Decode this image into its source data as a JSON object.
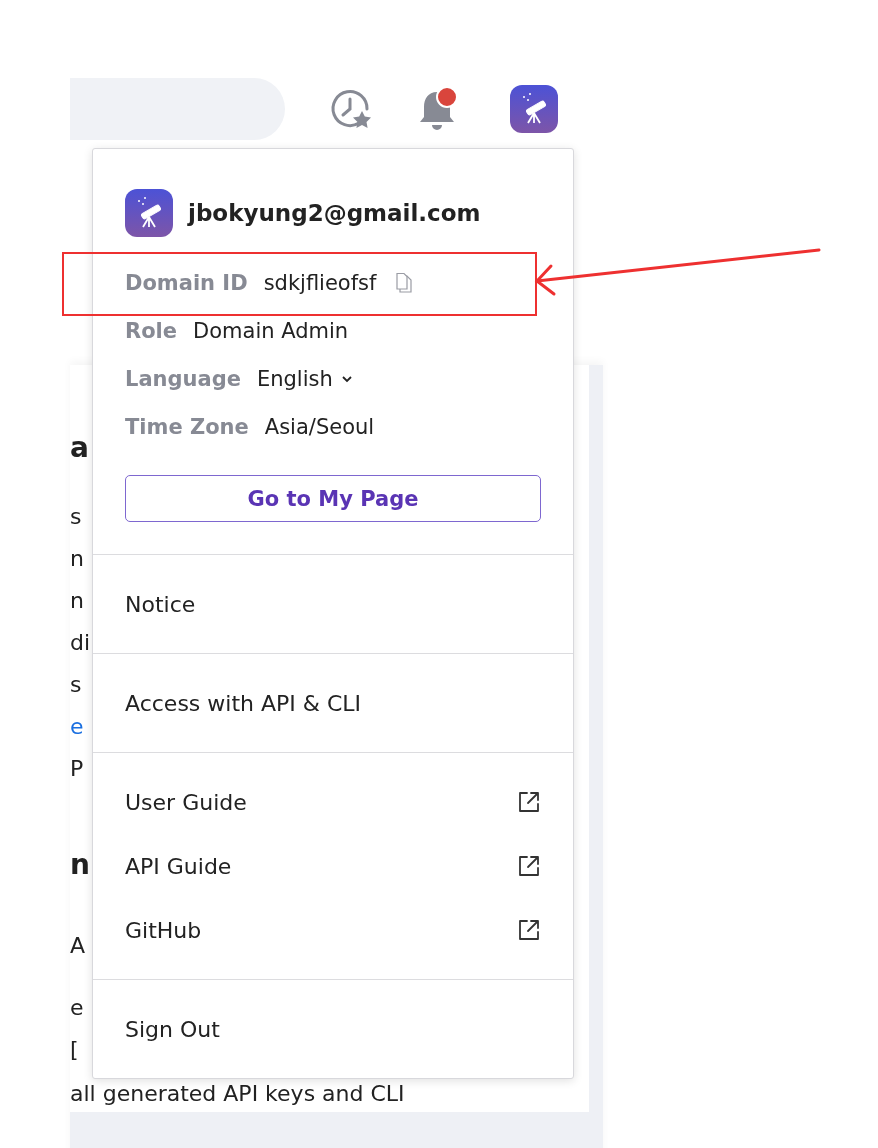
{
  "notifications": {
    "unread": true
  },
  "background_page": {
    "lines": [
      {
        "text": "a",
        "kind": "heading"
      },
      {
        "text": "s",
        "kind": "text"
      },
      {
        "text": "n",
        "kind": "text"
      },
      {
        "text": "n",
        "kind": "text"
      },
      {
        "text": "di",
        "kind": "text"
      },
      {
        "text": "s",
        "kind": "text"
      },
      {
        "text": "e",
        "kind": "link"
      },
      {
        "text": "P",
        "kind": "text"
      },
      {
        "text": "n",
        "kind": "heading"
      },
      {
        "text": "A",
        "kind": "text"
      },
      {
        "text": "e",
        "kind": "text"
      },
      {
        "text": "[",
        "kind": "text"
      },
      {
        "text": "all generated API keys and CLI",
        "kind": "text"
      }
    ]
  },
  "account_menu": {
    "email": "jbokyung2@gmail.com",
    "details": [
      {
        "label": "Domain ID",
        "value": "sdkjflieofsf",
        "kind": "copy",
        "highlighted": true
      },
      {
        "label": "Role",
        "value": "Domain Admin",
        "kind": "text",
        "highlighted": false
      },
      {
        "label": "Language",
        "value": "English",
        "kind": "select",
        "highlighted": false
      },
      {
        "label": "Time Zone",
        "value": "Asia/Seoul",
        "kind": "text",
        "highlighted": false
      }
    ],
    "primary_button": "Go to My Page",
    "sections": [
      {
        "items": [
          {
            "label": "Notice",
            "external": false
          }
        ]
      },
      {
        "items": [
          {
            "label": "Access with API & CLI",
            "external": false
          }
        ]
      },
      {
        "items": [
          {
            "label": "User Guide",
            "external": true
          },
          {
            "label": "API Guide",
            "external": true
          },
          {
            "label": "GitHub",
            "external": true
          }
        ]
      },
      {
        "items": [
          {
            "label": "Sign Out",
            "external": false
          }
        ]
      }
    ]
  }
}
